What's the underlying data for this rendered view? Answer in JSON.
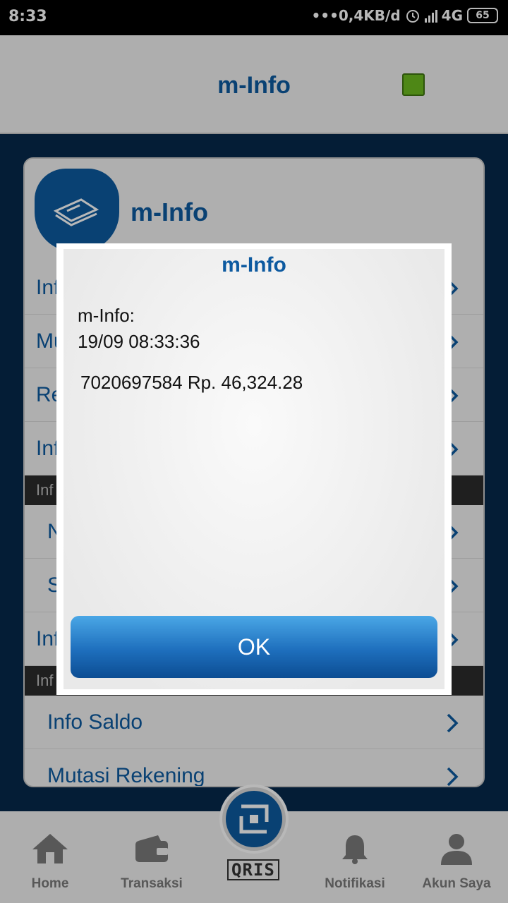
{
  "status_bar": {
    "time": "8:33",
    "net_speed": "•••0,4KB/d",
    "network": "4G",
    "battery": "65"
  },
  "header": {
    "title": "m-Info"
  },
  "panel": {
    "title": "m-Info",
    "rows": [
      "Inf",
      "Mu",
      "Re",
      "Inf"
    ],
    "section1": "Inf",
    "rows2": [
      "N",
      "S",
      "Inf"
    ],
    "section2": "Inf",
    "rows3": [
      "Info Saldo",
      "Mutasi Rekening"
    ]
  },
  "dialog": {
    "title": "m-Info",
    "line1": "m-Info:",
    "line2": "19/09 08:33:36",
    "amount_line": "7020697584 Rp. 46,324.28",
    "ok_label": "OK"
  },
  "bottom_nav": {
    "items": [
      {
        "label": "Home",
        "icon": "home-icon"
      },
      {
        "label": "Transaksi",
        "icon": "wallet-icon"
      },
      {
        "label": "Notifikasi",
        "icon": "bell-icon"
      },
      {
        "label": "Akun Saya",
        "icon": "user-icon"
      }
    ],
    "qris_label": "QRIS"
  },
  "colors": {
    "accent": "#0d5aa0",
    "indicator": "#6dbb1f",
    "ok_button": "#1e6fbd"
  }
}
